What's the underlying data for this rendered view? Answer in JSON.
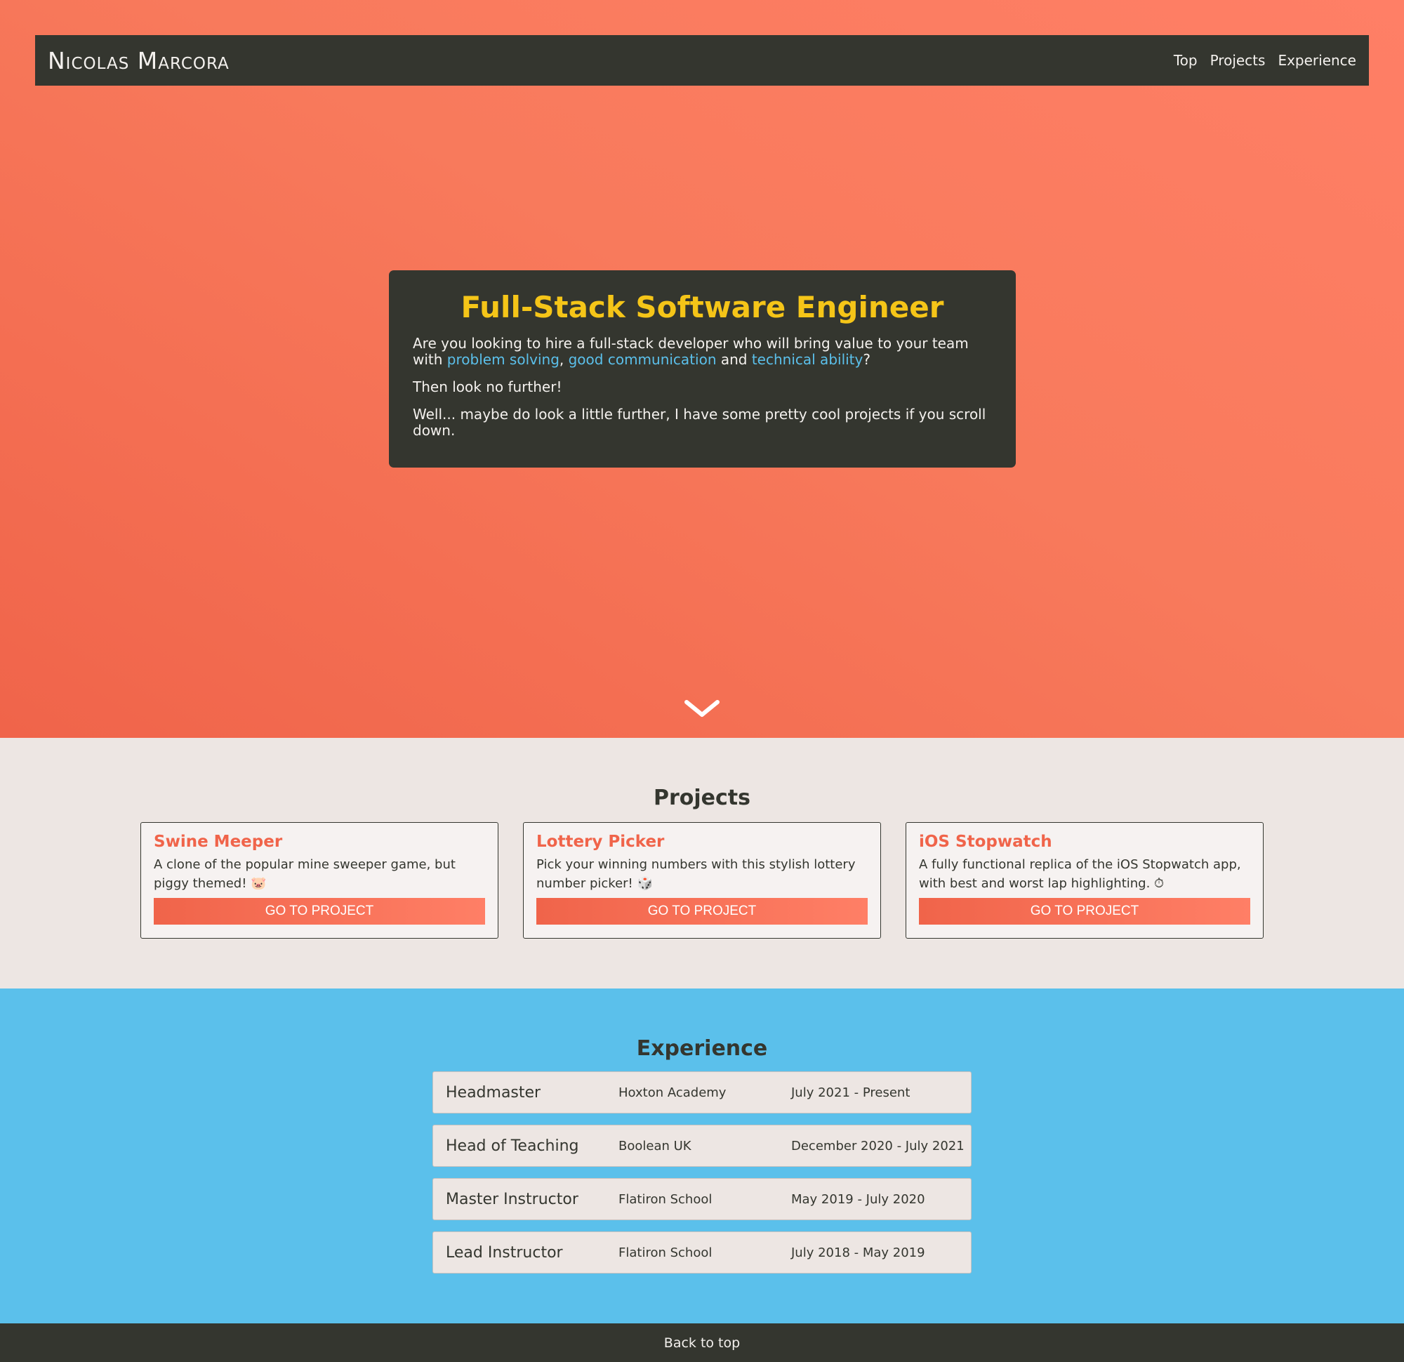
{
  "navbar": {
    "brand": "Nicolas Marcora",
    "links": [
      "Top",
      "Projects",
      "Experience"
    ]
  },
  "hero": {
    "title": "Full-Stack Software Engineer",
    "p1_start": "Are you looking to hire a full-stack developer who will bring value to your team with ",
    "p1_hl1": "problem solving",
    "p1_sep1": ", ",
    "p1_hl2": "good communication",
    "p1_sep2": " and ",
    "p1_hl3": "technical ability",
    "p1_end": "?",
    "p2": "Then look no further!",
    "p3": "Well... maybe do look a little further, I have some pretty cool projects if you scroll down.",
    "scroll_icon": "chevron-down-icon"
  },
  "projects": {
    "title": "Projects",
    "items": [
      {
        "title": "Swine Meeper",
        "desc": "A clone of the popular mine sweeper game, but piggy themed! 🐷",
        "button": "Go to project"
      },
      {
        "title": "Lottery Picker",
        "desc": "Pick your winning numbers with this stylish lottery number picker! 🎲",
        "button": "Go to project"
      },
      {
        "title": "iOS Stopwatch",
        "desc": "A fully functional replica of the iOS Stopwatch app, with best and worst lap highlighting. ⏱",
        "button": "Go to project"
      }
    ]
  },
  "experience": {
    "title": "Experience",
    "items": [
      {
        "role": "Headmaster",
        "company": "Hoxton Academy",
        "dates": "July 2021 - Present"
      },
      {
        "role": "Head of Teaching",
        "company": "Boolean UK",
        "dates": "December 2020 - July 2021"
      },
      {
        "role": "Master Instructor",
        "company": "Flatiron School",
        "dates": "May 2019 - July 2020"
      },
      {
        "role": "Lead Instructor",
        "company": "Flatiron School",
        "dates": "July 2018 - May 2019"
      }
    ]
  },
  "footer": {
    "link": "Back to top"
  },
  "colors": {
    "dark": "#34362f",
    "accent": "#f0644a",
    "highlight": "#5bc0eb",
    "title_yellow": "#f5c518",
    "light": "#ede6e3"
  }
}
